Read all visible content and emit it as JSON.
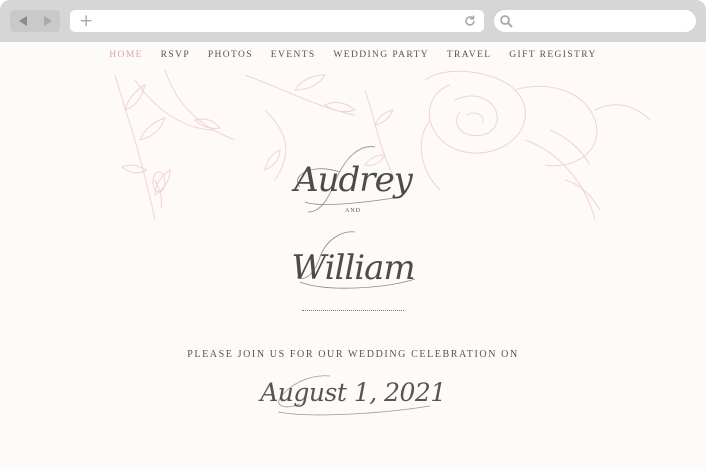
{
  "browser": {
    "url_value": "",
    "search_value": ""
  },
  "nav": {
    "items": [
      "HOME",
      "RSVP",
      "PHOTOS",
      "EVENTS",
      "WEDDING PARTY",
      "TRAVEL",
      "GIFT REGISTRY"
    ],
    "active": "HOME"
  },
  "hero": {
    "name1": "Audrey",
    "and": "AND",
    "name2": "William",
    "invite": "PLEASE JOIN US FOR OUR WEDDING CELEBRATION ON",
    "date": "August 1, 2021"
  },
  "colors": {
    "accent_pink": "#dba4ad",
    "floral_pink": "#f1d3d4",
    "page_bg": "#fefaf7",
    "text": "#555555"
  }
}
